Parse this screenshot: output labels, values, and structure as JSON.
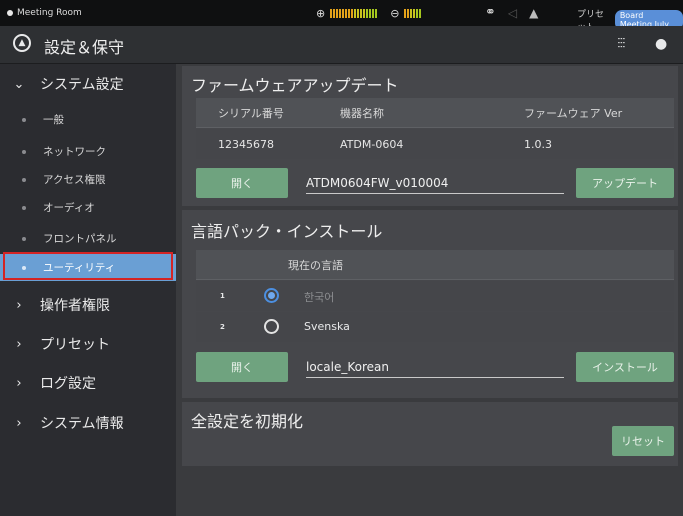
{
  "status_bar": {
    "room_name": "Meeting Room",
    "preset_label": "プリセット",
    "preset_value": "Board Meeting July",
    "icons": [
      "input-meter-icon",
      "output-meter-icon",
      "link-icon",
      "mute-icon",
      "warning-icon"
    ]
  },
  "header": {
    "title": "設定＆保守",
    "logo_icon": "audio-technica-logo",
    "mixer_icon": "mixer-icon",
    "user_icon": "user-icon"
  },
  "sidebar": {
    "system_settings": {
      "label": "システム設定",
      "items": [
        {
          "label": "一般"
        },
        {
          "label": "ネットワーク"
        },
        {
          "label": "アクセス権限"
        },
        {
          "label": "オーディオ"
        },
        {
          "label": "フロントパネル"
        },
        {
          "label": "ユーティリティ",
          "selected": true
        }
      ]
    },
    "sections": [
      {
        "label": "操作者権限"
      },
      {
        "label": "プリセット"
      },
      {
        "label": "ログ設定"
      },
      {
        "label": "システム情報"
      }
    ]
  },
  "firmware": {
    "title": "ファームウェアアップデート",
    "columns": [
      "シリアル番号",
      "機器名称",
      "ファームウェア Ver"
    ],
    "row": [
      "12345678",
      "ATDM-0604",
      "1.0.3"
    ],
    "open_label": "開く",
    "file_name": "ATDM0604FW_v010004",
    "update_label": "アップデート"
  },
  "language": {
    "title": "言語パック・インストール",
    "column": "現在の言語",
    "rows": [
      {
        "num": "1",
        "name": "한국어",
        "selected": true
      },
      {
        "num": "2",
        "name": "Svenska",
        "selected": false
      }
    ],
    "open_label": "開く",
    "file_name": "locale_Korean",
    "install_label": "インストール"
  },
  "reset": {
    "title": "全設定を初期化",
    "reset_label": "リセット"
  },
  "colors": {
    "accent_green": "#6fa37f",
    "selected_blue": "#6a9fd4",
    "highlight_red": "#d42424"
  }
}
